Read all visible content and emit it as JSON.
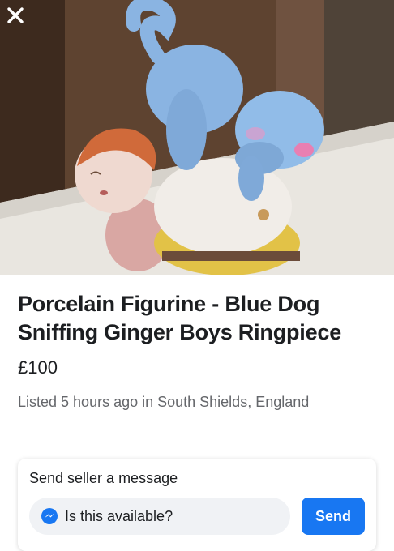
{
  "listing": {
    "photo_alt": "listing-photo",
    "title": "Porcelain Figurine - Blue Dog Sniffing Ginger Boys Ringpiece",
    "price": "£100",
    "listed": "Listed 5 hours ago in South Shields, England"
  },
  "message": {
    "heading": "Send seller a message",
    "input_value": "Is this available?",
    "send_label": "Send"
  },
  "icons": {
    "close": "close-icon",
    "messenger": "messenger-icon"
  },
  "colors": {
    "accent": "#1877f2",
    "secondary_text": "#65676b",
    "input_bg": "#f0f2f5"
  }
}
